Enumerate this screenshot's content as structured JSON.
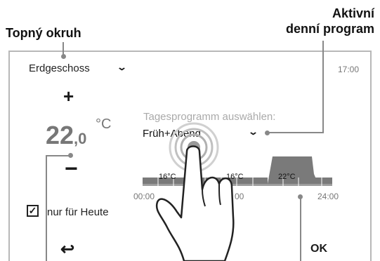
{
  "callouts": {
    "heating_circuit": "Topný okruh",
    "active_program_line1": "Aktivní",
    "active_program_line2": "denní program"
  },
  "device": {
    "zone": "Erdgeschoss",
    "clock": "17:00",
    "temperature_int": "22",
    "temperature_frac": ",0",
    "temperature_unit": "°C",
    "plus_label": "+",
    "minus_label": "−",
    "day_program_title": "Tagesprogramm auswählen:",
    "day_program_value": "Früh+Abend",
    "today_only_label": "nur für Heute",
    "today_only_checked": true,
    "checkmark": "✓",
    "back_label": "↩",
    "ok_label": "OK",
    "timeline": {
      "segment_labels": [
        "16°C",
        "16°C",
        "22°C"
      ],
      "tick_labels": [
        "00:00",
        "00",
        "24:00"
      ],
      "low_color": "#7a7a7a",
      "high_color": "#7a7a7a"
    }
  },
  "icons": {
    "caret": "chevron-down-icon",
    "hand": "touch-hand-icon"
  }
}
